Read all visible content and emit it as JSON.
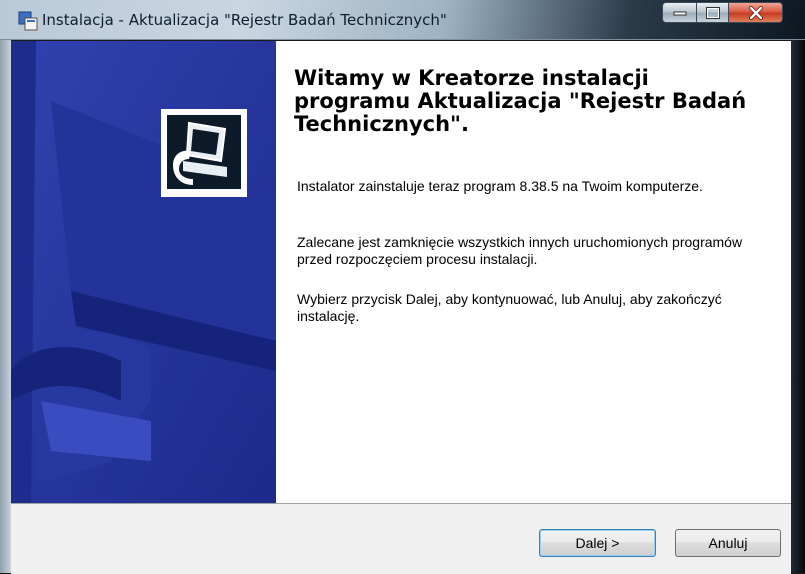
{
  "window": {
    "title": "Instalacja - Aktualizacja \"Rejestr Badań Technicznych\""
  },
  "controls": {
    "minimize_icon": "minimize-icon",
    "maximize_icon": "maximize-icon",
    "close_icon": "close-icon"
  },
  "main": {
    "title": "Witamy w Kreatorze instalacji programu Aktualizacja \"Rejestr Badań Technicznych\".",
    "paragraphs": [
      "Instalator zainstaluje teraz program 8.38.5 na Twoim komputerze.",
      "Zalecane jest zamknięcie wszystkich innych uruchomionych programów przed rozpoczęciem procesu instalacji.",
      "Wybierz przycisk Dalej, aby kontynuować, lub Anuluj, aby zakończyć instalację."
    ]
  },
  "buttons": {
    "next": "Dalej >",
    "cancel": "Anuluj"
  },
  "colors": {
    "wizard_art": "#2d3fa6",
    "content_bg": "#ffffff",
    "button_bar": "#f0f0f0"
  }
}
